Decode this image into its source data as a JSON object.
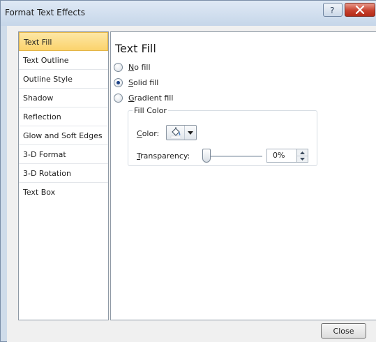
{
  "window": {
    "title": "Format Text Effects",
    "help_icon": "help-icon",
    "close_icon": "close-icon"
  },
  "nav": {
    "items": [
      {
        "label": "Text Fill",
        "selected": true
      },
      {
        "label": "Text Outline"
      },
      {
        "label": "Outline Style"
      },
      {
        "label": "Shadow"
      },
      {
        "label": "Reflection"
      },
      {
        "label": "Glow and Soft Edges"
      },
      {
        "label": "3-D Format"
      },
      {
        "label": "3-D Rotation"
      },
      {
        "label": "Text Box"
      }
    ]
  },
  "content": {
    "heading": "Text Fill",
    "options": [
      {
        "mnemonic": "N",
        "rest": "o fill",
        "checked": false
      },
      {
        "mnemonic": "S",
        "rest": "olid fill",
        "checked": true
      },
      {
        "mnemonic": "G",
        "rest": "radient fill",
        "checked": false
      }
    ],
    "fill_color": {
      "group_label": "Fill Color",
      "color_mnemonic": "C",
      "color_rest": "olor:",
      "color_icon": "paint-bucket-icon",
      "transparency_mnemonic": "T",
      "transparency_rest": "ransparency:",
      "transparency_value": "0%",
      "transparency_level": 0
    }
  },
  "footer": {
    "close_label": "Close"
  },
  "colors": {
    "selected_item": "#fbd36c",
    "close_button_red": "#c7422f"
  }
}
